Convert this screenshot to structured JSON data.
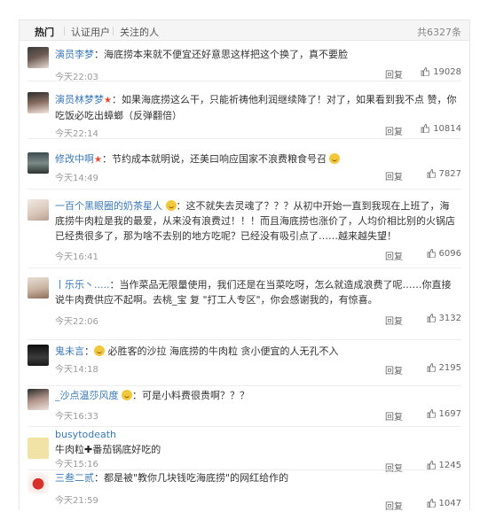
{
  "tabs": [
    {
      "label": "热门"
    },
    {
      "label": "认证用户"
    },
    {
      "label": "关注的人"
    }
  ],
  "total": "共6327条",
  "comments": [
    {
      "name": "演员李梦",
      "text": "海底捞本来就不便宜还好意思这样把这个换了，真不要脸",
      "time": "今天22:03",
      "reply": "回复",
      "likes": "19028"
    },
    {
      "name": "演员林梦梦",
      "text": "如果海底捞这么干，只能祈祷他利润继续降了！对了，如果看到我不点 赞，你吃饭必吃出蟑螂（反弹翻倍）",
      "time": "今天22:14",
      "reply": "回复",
      "likes": "10814"
    },
    {
      "name": "修改中啊",
      "text": "节约成本就明说，还美曰响应国家不浪费粮食号召",
      "time": "今天14:49",
      "reply": "回复",
      "likes": "7827"
    },
    {
      "name": "一百个黑眼圈的奶茶星人",
      "text": "这不就失去灵魂了？？？从初中开始一直到我现在上班了，海底捞牛肉粒是我的最爱，从来没有浪费过！！！而且海底捞也涨价了，人均价相比别的火锅店已经贵很多了，那为啥不去别的地方吃呢？已经没有吸引点了……越来越失望！",
      "time": "今天16:41",
      "reply": "回复",
      "likes": "6096"
    },
    {
      "name": "丨乐乐丶.....",
      "text": "当作菜品无限量使用，我们还是在当菜吃呀，怎么就造成浪费了呢……你直接说牛肉费供应不起啊。去桃_宝 复 \"打工人专区\"，你会感谢我的，有惊喜。",
      "time": "今天22:06",
      "reply": "回复",
      "likes": "3132"
    },
    {
      "name": "鬼未言",
      "text": "必胜客的沙拉 海底捞的牛肉粒 贪小便宜的人无孔不入",
      "time": "今天14:18",
      "reply": "回复",
      "likes": "2195"
    },
    {
      "name": "_沙点温莎风度",
      "text": "可是小料费很贵啊？？？",
      "time": "今天16:33",
      "reply": "回复",
      "likes": "1697"
    },
    {
      "name": "busytodeath",
      "text_a": "牛肉粒",
      "text_b": "番茄锅底好吃的",
      "time": "今天15:16",
      "reply": "回复",
      "likes": "1245"
    },
    {
      "name": "三叁二贰",
      "text": "都是被\"教你几块钱吃海底捞\"的网红给作的",
      "time": "今天21:59",
      "reply": "回复",
      "likes": "1047"
    }
  ],
  "colors": {
    "name": "#3b78b5",
    "time": "#9a9a9a",
    "star": "#e8452c"
  }
}
